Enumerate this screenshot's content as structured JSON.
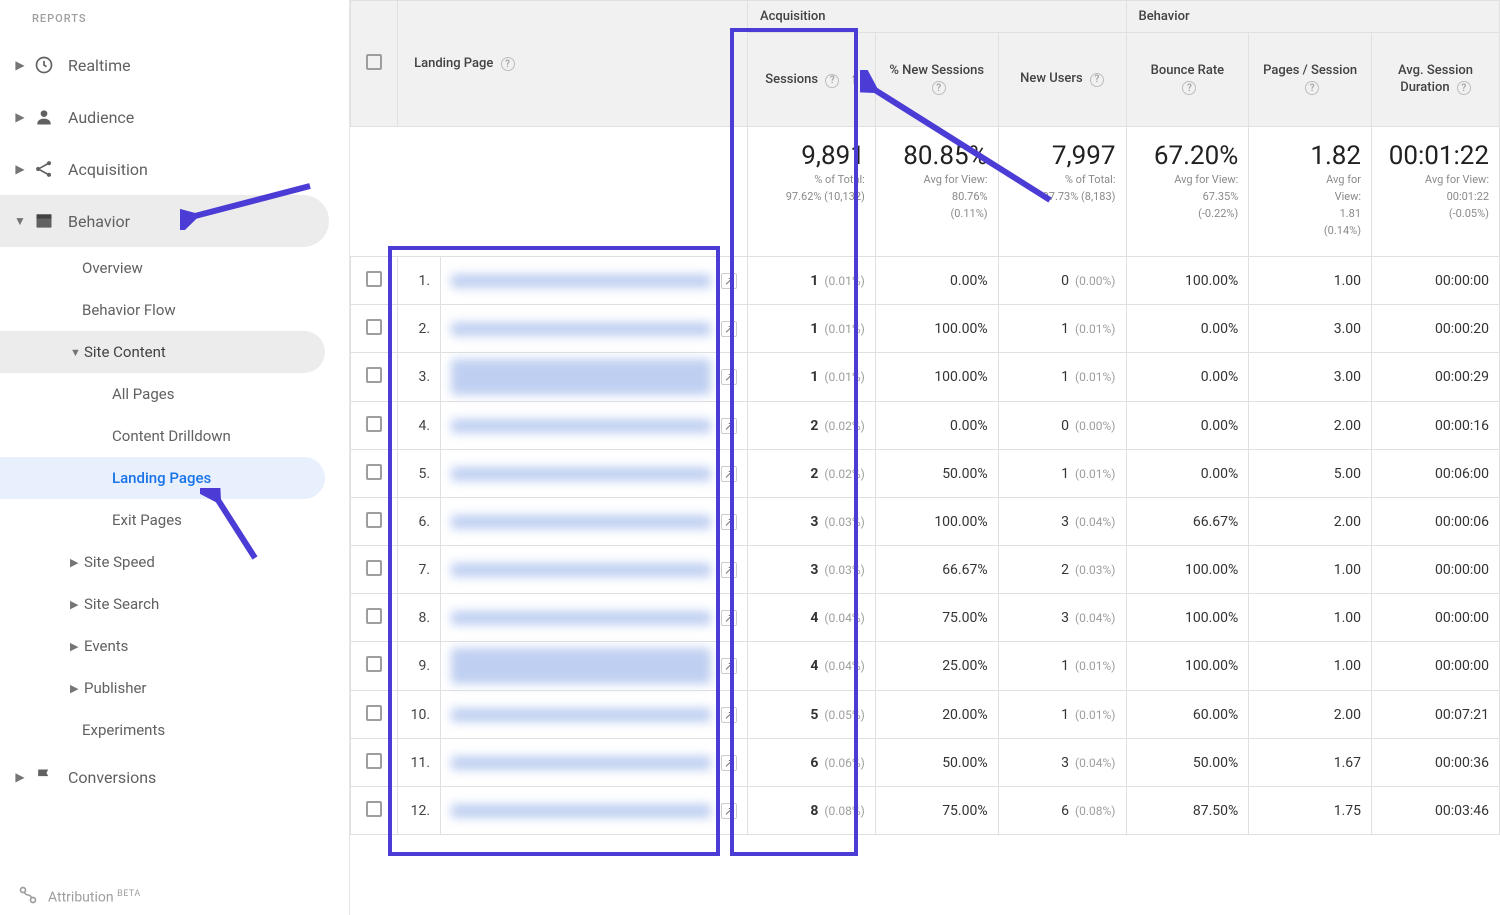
{
  "sidebar": {
    "heading": "REPORTS",
    "items": {
      "realtime": "Realtime",
      "audience": "Audience",
      "acquisition": "Acquisition",
      "behavior": "Behavior",
      "conversions": "Conversions"
    },
    "behavior_children": {
      "overview": "Overview",
      "behavior_flow": "Behavior Flow",
      "site_content": "Site Content",
      "site_speed": "Site Speed",
      "site_search": "Site Search",
      "events": "Events",
      "publisher": "Publisher",
      "experiments": "Experiments"
    },
    "site_content_children": {
      "all_pages": "All Pages",
      "content_drilldown": "Content Drilldown",
      "landing_pages": "Landing Pages",
      "exit_pages": "Exit Pages"
    },
    "attribution": {
      "label": "Attribution",
      "badge": "BETA"
    }
  },
  "table": {
    "groups": {
      "acquisition": "Acquisition",
      "behavior": "Behavior"
    },
    "dim_header": "Landing Page",
    "metrics": {
      "sessions": "Sessions",
      "pct_new_sessions": "% New Sessions",
      "new_users": "New Users",
      "bounce_rate": "Bounce Rate",
      "pages_per_session": "Pages / Session",
      "avg_session_duration": "Avg. Session Duration"
    },
    "summary": {
      "sessions": {
        "big": "9,891",
        "sub1": "% of Total:",
        "sub2": "97.62% (10,132)"
      },
      "pct_new_sessions": {
        "big": "80.85%",
        "sub1": "Avg for View:",
        "sub2": "80.76%",
        "sub3": "(0.11%)"
      },
      "new_users": {
        "big": "7,997",
        "sub1": "% of Total:",
        "sub2": "97.73% (8,183)"
      },
      "bounce_rate": {
        "big": "67.20%",
        "sub1": "Avg for View:",
        "sub2": "67.35%",
        "sub3": "(-0.22%)"
      },
      "pages_per_session": {
        "big": "1.82",
        "sub1": "Avg for",
        "sub2": "View:",
        "sub3": "1.81",
        "sub4": "(0.14%)"
      },
      "avg_session_duration": {
        "big": "00:01:22",
        "sub1": "Avg for View:",
        "sub2": "00:01:22",
        "sub3": "(-0.05%)"
      }
    },
    "rows": [
      {
        "idx": "1.",
        "sessions": "1",
        "sessions_pct": "(0.01%)",
        "pct_new": "0.00%",
        "new_users": "0",
        "new_users_pct": "(0.00%)",
        "bounce": "100.00%",
        "pps": "1.00",
        "dur": "00:00:00"
      },
      {
        "idx": "2.",
        "sessions": "1",
        "sessions_pct": "(0.01%)",
        "pct_new": "100.00%",
        "new_users": "1",
        "new_users_pct": "(0.01%)",
        "bounce": "0.00%",
        "pps": "3.00",
        "dur": "00:00:20"
      },
      {
        "idx": "3.",
        "sessions": "1",
        "sessions_pct": "(0.01%)",
        "pct_new": "100.00%",
        "new_users": "1",
        "new_users_pct": "(0.01%)",
        "bounce": "0.00%",
        "pps": "3.00",
        "dur": "00:00:29"
      },
      {
        "idx": "4.",
        "sessions": "2",
        "sessions_pct": "(0.02%)",
        "pct_new": "0.00%",
        "new_users": "0",
        "new_users_pct": "(0.00%)",
        "bounce": "0.00%",
        "pps": "2.00",
        "dur": "00:00:16"
      },
      {
        "idx": "5.",
        "sessions": "2",
        "sessions_pct": "(0.02%)",
        "pct_new": "50.00%",
        "new_users": "1",
        "new_users_pct": "(0.01%)",
        "bounce": "0.00%",
        "pps": "5.00",
        "dur": "00:06:00"
      },
      {
        "idx": "6.",
        "sessions": "3",
        "sessions_pct": "(0.03%)",
        "pct_new": "100.00%",
        "new_users": "3",
        "new_users_pct": "(0.04%)",
        "bounce": "66.67%",
        "pps": "2.00",
        "dur": "00:00:06"
      },
      {
        "idx": "7.",
        "sessions": "3",
        "sessions_pct": "(0.03%)",
        "pct_new": "66.67%",
        "new_users": "2",
        "new_users_pct": "(0.03%)",
        "bounce": "100.00%",
        "pps": "1.00",
        "dur": "00:00:00"
      },
      {
        "idx": "8.",
        "sessions": "4",
        "sessions_pct": "(0.04%)",
        "pct_new": "75.00%",
        "new_users": "3",
        "new_users_pct": "(0.04%)",
        "bounce": "100.00%",
        "pps": "1.00",
        "dur": "00:00:00"
      },
      {
        "idx": "9.",
        "sessions": "4",
        "sessions_pct": "(0.04%)",
        "pct_new": "25.00%",
        "new_users": "1",
        "new_users_pct": "(0.01%)",
        "bounce": "100.00%",
        "pps": "1.00",
        "dur": "00:00:00"
      },
      {
        "idx": "10.",
        "sessions": "5",
        "sessions_pct": "(0.05%)",
        "pct_new": "20.00%",
        "new_users": "1",
        "new_users_pct": "(0.01%)",
        "bounce": "60.00%",
        "pps": "2.00",
        "dur": "00:07:21"
      },
      {
        "idx": "11.",
        "sessions": "6",
        "sessions_pct": "(0.06%)",
        "pct_new": "50.00%",
        "new_users": "3",
        "new_users_pct": "(0.04%)",
        "bounce": "50.00%",
        "pps": "1.67",
        "dur": "00:00:36"
      },
      {
        "idx": "12.",
        "sessions": "8",
        "sessions_pct": "(0.08%)",
        "pct_new": "75.00%",
        "new_users": "6",
        "new_users_pct": "(0.08%)",
        "bounce": "87.50%",
        "pps": "1.75",
        "dur": "00:03:46"
      }
    ]
  },
  "annotations": {
    "color": "#4c3cd6"
  }
}
